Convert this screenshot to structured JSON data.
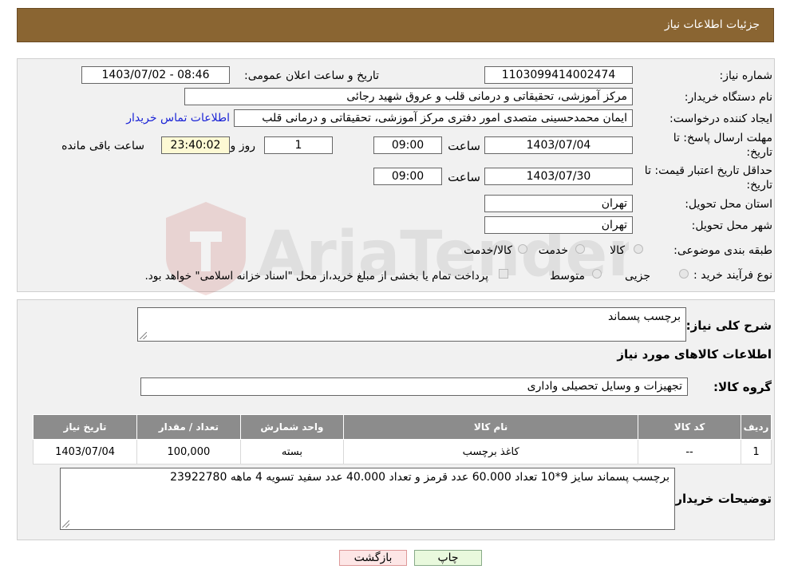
{
  "header": {
    "title": "جزئیات اطلاعات نیاز"
  },
  "form": {
    "need_number_label": "شماره نیاز:",
    "need_number": "1103099414002474",
    "announce_label": "تاریخ و ساعت اعلان عمومی:",
    "announce_value": "1403/07/02 - 08:46",
    "buyer_org_label": "نام دستگاه خریدار:",
    "buyer_org": "مرکز آموزشی، تحقیقاتی و درمانی قلب و عروق شهید رجائی",
    "creator_label": "ایجاد کننده درخواست:",
    "creator": "ایمان محمدحسینی متصدی امور دفتری مرکز آموزشی، تحقیقاتی و درمانی قلب",
    "contact_link": "اطلاعات تماس خریدار",
    "deadline_label": "مهلت ارسال پاسخ: تا تاریخ:",
    "deadline_date": "1403/07/04",
    "time_label": "ساعت",
    "deadline_time": "09:00",
    "days_value": "1",
    "days_label": "روز و",
    "remaining_time": "23:40:02",
    "remaining_label": "ساعت باقی مانده",
    "validity_label": "حداقل تاریخ اعتبار قیمت: تا تاریخ:",
    "validity_date": "1403/07/30",
    "validity_time": "09:00",
    "province_label": "استان محل تحویل:",
    "province": "تهران",
    "city_label": "شهر محل تحویل:",
    "city": "تهران",
    "category_label": "طبقه بندی موضوعی:",
    "category_options": [
      "کالا",
      "خدمت",
      "کالا/خدمت"
    ],
    "process_label": "نوع فرآیند خرید :",
    "process_options": [
      "جزیی",
      "متوسط"
    ],
    "payment_note": "پرداخت تمام یا بخشی از مبلغ خرید،از محل \"اسناد خزانه اسلامی\" خواهد بود."
  },
  "details": {
    "summary_label": "شرح کلی نیاز:",
    "summary": "برچسب پسماند",
    "goods_info_title": "اطلاعات کالاهای مورد نیاز",
    "goods_group_label": "گروه کالا:",
    "goods_group": "تجهیزات و وسایل تحصیلی واداری",
    "table": {
      "headers": [
        "ردیف",
        "کد کالا",
        "نام کالا",
        "واحد شمارش",
        "تعداد / مقدار",
        "تاریخ نیاز"
      ],
      "rows": [
        [
          "1",
          "--",
          "کاغذ برچسب",
          "بسته",
          "100,000",
          "1403/07/04"
        ]
      ]
    },
    "buyer_notes_label": "توضیحات خریدار:",
    "buyer_notes": "برچسب پسماند سایز 9*10 تعداد 60.000 عدد قرمز و تعداد 40.000 عدد سفید تسویه 4 ماهه 23922780"
  },
  "buttons": {
    "print": "چاپ",
    "back": "بازگشت"
  },
  "watermark": {
    "text": "AriaTender.neT"
  },
  "colors": {
    "header_bg": "#8a6532",
    "panel_bg": "#f1f1f1",
    "link": "#1a23d6",
    "back_button_bg": "#fde6e6",
    "print_button_bg": "#e9f9dd",
    "remaining_bg": "#fdf9d4"
  }
}
